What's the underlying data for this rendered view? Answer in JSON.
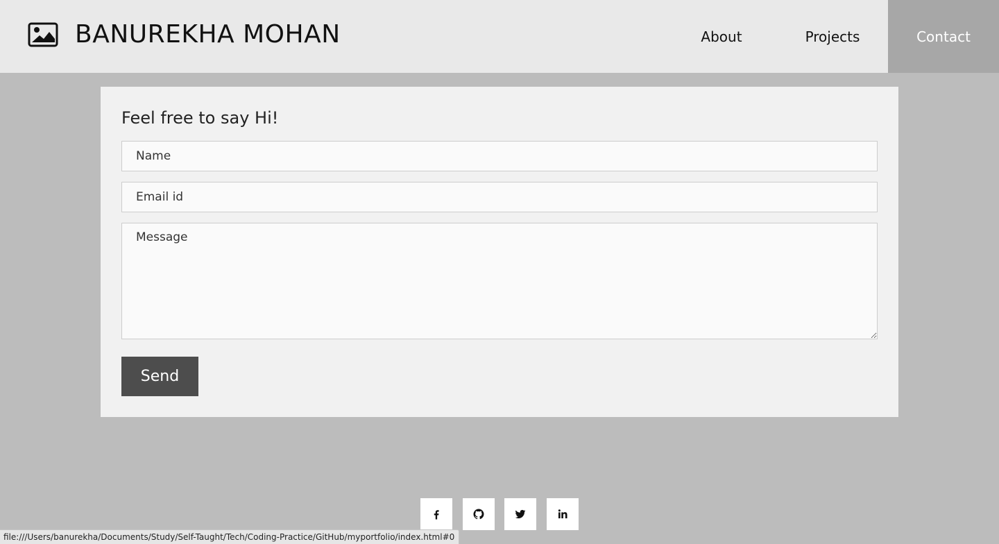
{
  "header": {
    "brand": "BANUREKHA MOHAN",
    "logo_icon": "image-icon",
    "nav": [
      {
        "label": "About"
      },
      {
        "label": "Projects"
      },
      {
        "label": "Contact",
        "active": true
      }
    ]
  },
  "contact_form": {
    "title": "Feel free to say Hi!",
    "name_placeholder": "Name",
    "email_placeholder": "Email id",
    "message_placeholder": "Message",
    "send_label": "Send"
  },
  "social": [
    {
      "icon": "facebook-icon"
    },
    {
      "icon": "github-icon"
    },
    {
      "icon": "twitter-icon"
    },
    {
      "icon": "linkedin-icon"
    }
  ],
  "status_bar": {
    "url": "file:///Users/banurekha/Documents/Study/Self-Taught/Tech/Coding-Practice/GitHub/myportfolio/index.html#0"
  },
  "colors": {
    "page_bg": "#bcbcbc",
    "header_bg": "#e9e9e9",
    "active_nav_bg": "#a7a7a7",
    "card_bg": "#f1f1f1",
    "button_bg": "#4d4d4d"
  }
}
